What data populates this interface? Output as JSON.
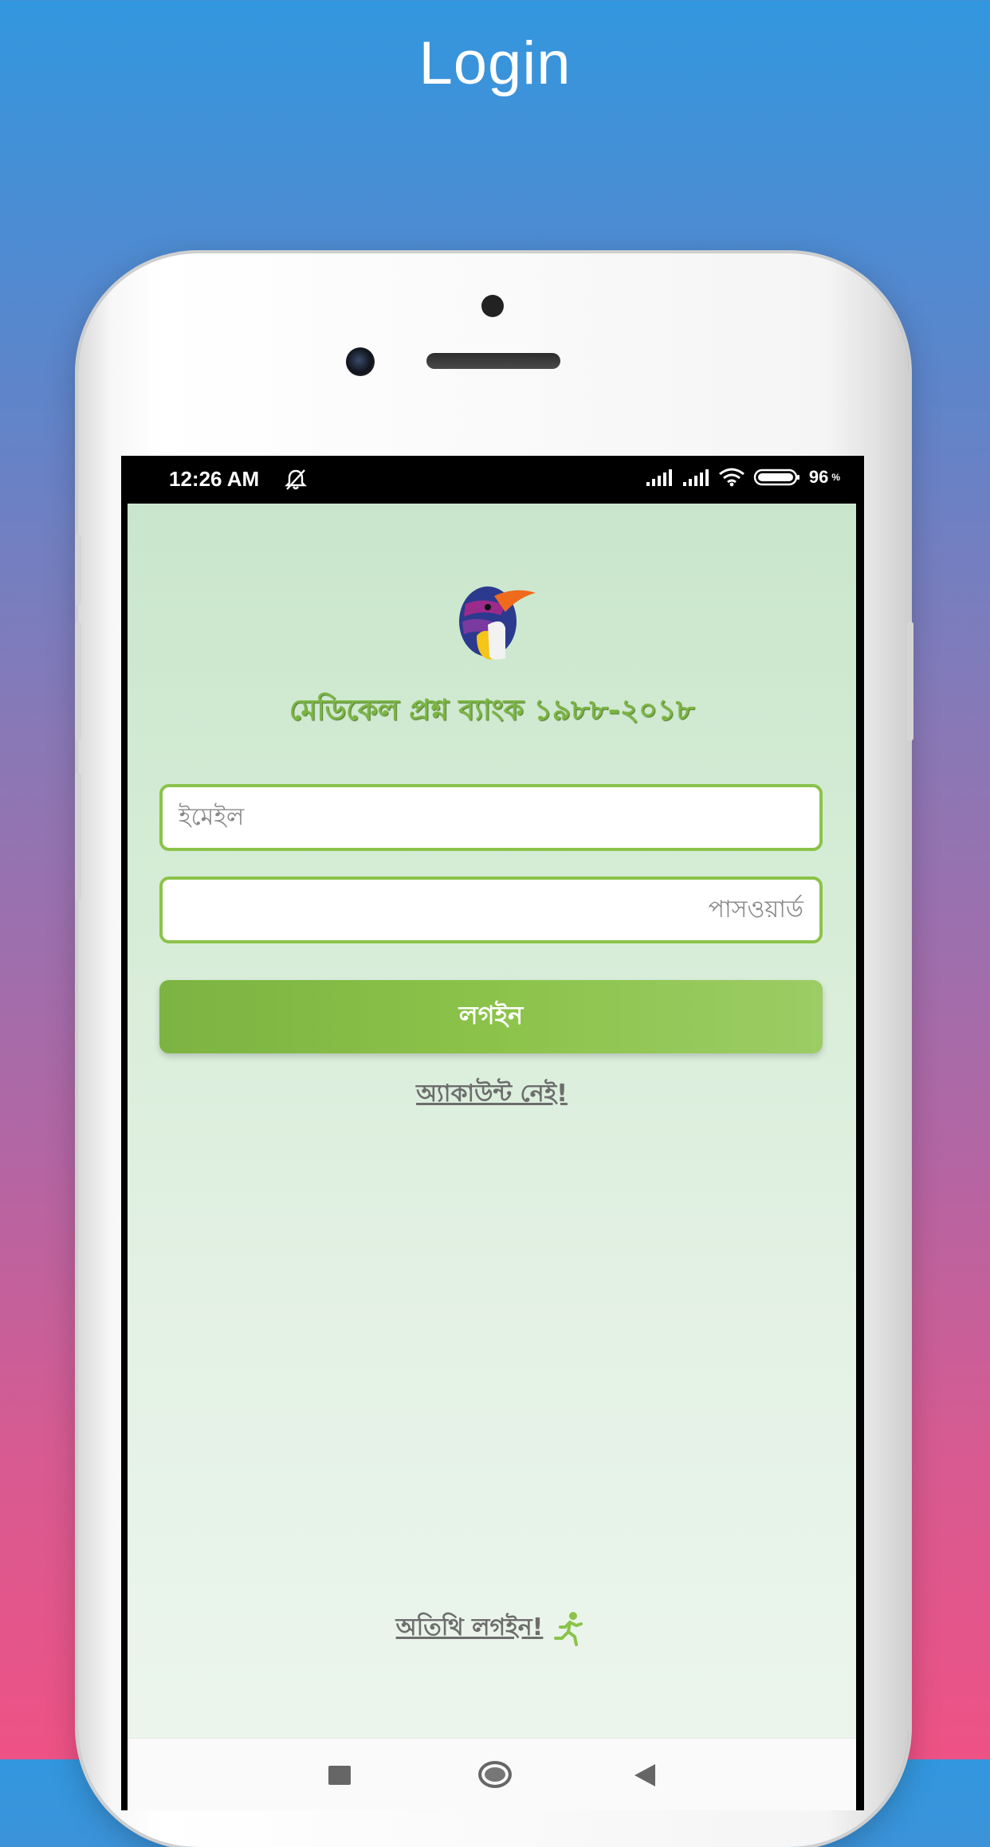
{
  "page_title": "Login",
  "status_bar": {
    "time": "12:26 AM",
    "battery": "96",
    "battery_unit": "%"
  },
  "app": {
    "title": "মেডিকেল প্রশ্ন ব্যাংক ১৯৮৮-২০১৮",
    "email_placeholder": "ইমেইল",
    "password_placeholder": "পাসওয়ার্ড",
    "login_button": "লগইন",
    "no_account_link": "অ্যাকাউন্ট নেই!",
    "guest_login_link": "অতিথি লগইন!"
  },
  "colors": {
    "accent": "#8bc34a",
    "title_text": "#7cb444",
    "link_text": "#6d6d6d"
  },
  "icons": {
    "logo": "bird-logo",
    "guest": "running-person-icon"
  }
}
